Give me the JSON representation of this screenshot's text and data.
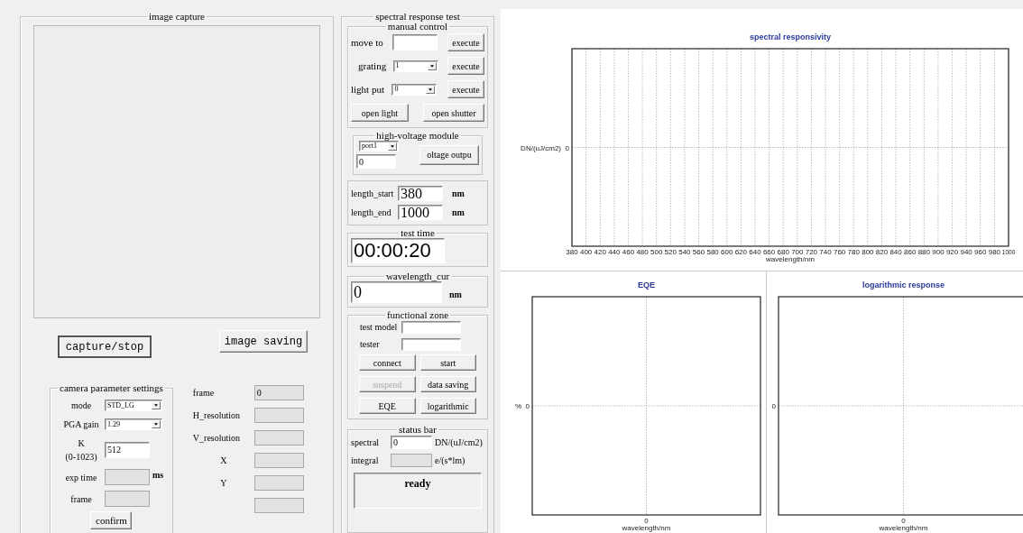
{
  "image_capture": {
    "title": "image capture",
    "buttons": [
      {
        "label": "capture/stop",
        "default": true
      },
      {
        "label": "image saving",
        "default": false
      }
    ],
    "camera_settings": {
      "title": "camera parameter settings",
      "fields": [
        {
          "kind": "dropdown",
          "label": "mode",
          "value": "STD_LG",
          "readonly": false
        },
        {
          "kind": "dropdown",
          "label": "PGA gain",
          "value": "1.29",
          "readonly": false
        },
        {
          "kind": "text",
          "label": "K",
          "sublabel": "(0-1023)",
          "value": "512",
          "readonly": false
        },
        {
          "kind": "text",
          "label": "exp time",
          "unit": "ms",
          "readonly": true
        },
        {
          "kind": "text",
          "label": "frame",
          "readonly": true
        }
      ],
      "confirm": "confirm"
    },
    "info": [
      {
        "label": "frame",
        "value": "0",
        "readonly": true
      },
      {
        "label": "H_resolution",
        "readonly": true
      },
      {
        "label": "V_resolution",
        "readonly": true
      },
      {
        "label": "X",
        "readonly": true
      },
      {
        "label": "Y",
        "readonly": true
      },
      {
        "readonly": true
      }
    ]
  },
  "spectral_test": {
    "title": "spectral response test",
    "manual_control": {
      "title": "manual control",
      "rows": [
        {
          "kind": "input",
          "label": "move to",
          "button": "execute"
        },
        {
          "kind": "dropdown",
          "label": "grating",
          "value": "1",
          "button": "execute"
        },
        {
          "kind": "dropdown",
          "label": "light put",
          "value": "0",
          "button": "execute"
        }
      ],
      "buttons": [
        "open light",
        "open shutter"
      ]
    },
    "high_voltage": {
      "title": "high-voltage module",
      "port": "port1",
      "value": "0",
      "button": "oltage outpu"
    },
    "range": [
      {
        "label": "length_start",
        "value": "380",
        "unit": "nm"
      },
      {
        "label": "length_end",
        "value": "1000",
        "unit": "nm"
      }
    ],
    "test_time": {
      "title": "test time",
      "value": "00:00:20"
    },
    "wavelength_cur": {
      "title": "wavelength_cur",
      "value": "0",
      "unit": "nm"
    },
    "functional_zone": {
      "title": "functional zone",
      "fields": [
        {
          "label": "test model"
        },
        {
          "label": "tester"
        }
      ],
      "buttons": [
        {
          "label": "connect",
          "disabled": false
        },
        {
          "label": "start",
          "disabled": false
        },
        {
          "label": "suspend",
          "disabled": true
        },
        {
          "label": "data saving",
          "disabled": false
        },
        {
          "label": "EQE",
          "disabled": false
        },
        {
          "label": "logarithmic",
          "disabled": false
        }
      ]
    },
    "status_bar": {
      "title": "status bar",
      "rows": [
        {
          "label": "spectral",
          "value": "0",
          "unit": "DN/(uJ/cm2)",
          "readonly": false
        },
        {
          "label": "integral",
          "unit": "e/(s*lm)",
          "readonly": true
        }
      ],
      "status": "ready"
    }
  },
  "charts": [
    {
      "title": "spectral responsivity",
      "ylabel": "DN/(uJ/cm2)",
      "y_tick_labels": [
        "0"
      ],
      "xlabel": "wavelength/nm",
      "x_tick_labels": [
        "380",
        "400",
        "420",
        "440",
        "460",
        "480",
        "500",
        "520",
        "540",
        "560",
        "580",
        "600",
        "620",
        "640",
        "660",
        "680",
        "700",
        "720",
        "740",
        "760",
        "780",
        "800",
        "820",
        "840",
        "860",
        "880",
        "900",
        "920",
        "940",
        "960",
        "980",
        "1000"
      ]
    },
    {
      "title": "EQE",
      "ylabel": "%",
      "y_tick_labels": [
        "0"
      ],
      "x_tick_labels": [
        "0"
      ],
      "xlabel": "wavelength/nm"
    },
    {
      "title": "logarithmic response",
      "y_tick_labels": [
        "0"
      ],
      "x_tick_labels": [
        "0"
      ],
      "xlabel": "wavelength/nm"
    }
  ]
}
